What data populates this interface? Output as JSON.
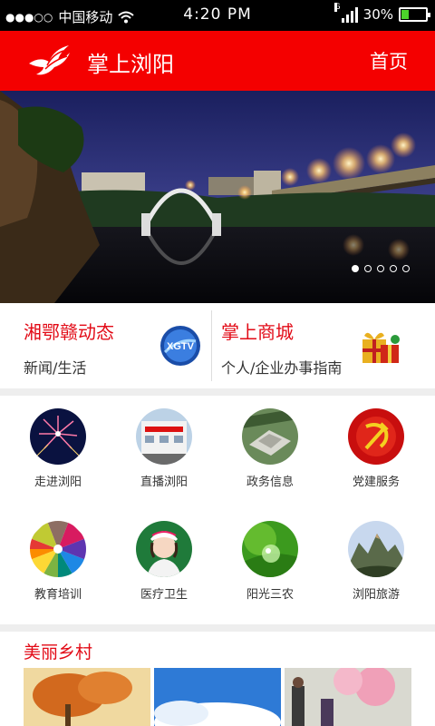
{
  "status_bar": {
    "signal_dots": "●●●○○",
    "carrier": "中国移动",
    "time": "4:20 PM",
    "network": "G",
    "battery_percent": "30%",
    "battery_level": 0.3
  },
  "header": {
    "title": "掌上浏阳",
    "home_link": "首页",
    "background_color": "#f40000"
  },
  "banner": {
    "pages": 5,
    "active_page": 1
  },
  "features": [
    {
      "title": "湘鄂赣动态",
      "subtitle": "新闻/生活",
      "icon": "xgtv-logo-icon"
    },
    {
      "title": "掌上商城",
      "subtitle": "个人/企业办事指南",
      "icon": "gift-box-icon"
    }
  ],
  "grid": [
    {
      "label": "走进浏阳",
      "icon": "fireworks-icon"
    },
    {
      "label": "直播浏阳",
      "icon": "building-icon"
    },
    {
      "label": "政务信息",
      "icon": "aerial-building-icon"
    },
    {
      "label": "党建服务",
      "icon": "party-emblem-icon"
    },
    {
      "label": "教育培训",
      "icon": "colored-pencils-icon"
    },
    {
      "label": "医疗卫生",
      "icon": "nurse-icon"
    },
    {
      "label": "阳光三农",
      "icon": "water-drop-leaf-icon"
    },
    {
      "label": "浏阳旅游",
      "icon": "mountain-icon"
    }
  ],
  "section": {
    "title": "美丽乡村"
  },
  "colors": {
    "accent_red": "#e20a16",
    "battery_green": "#4cd32b"
  }
}
